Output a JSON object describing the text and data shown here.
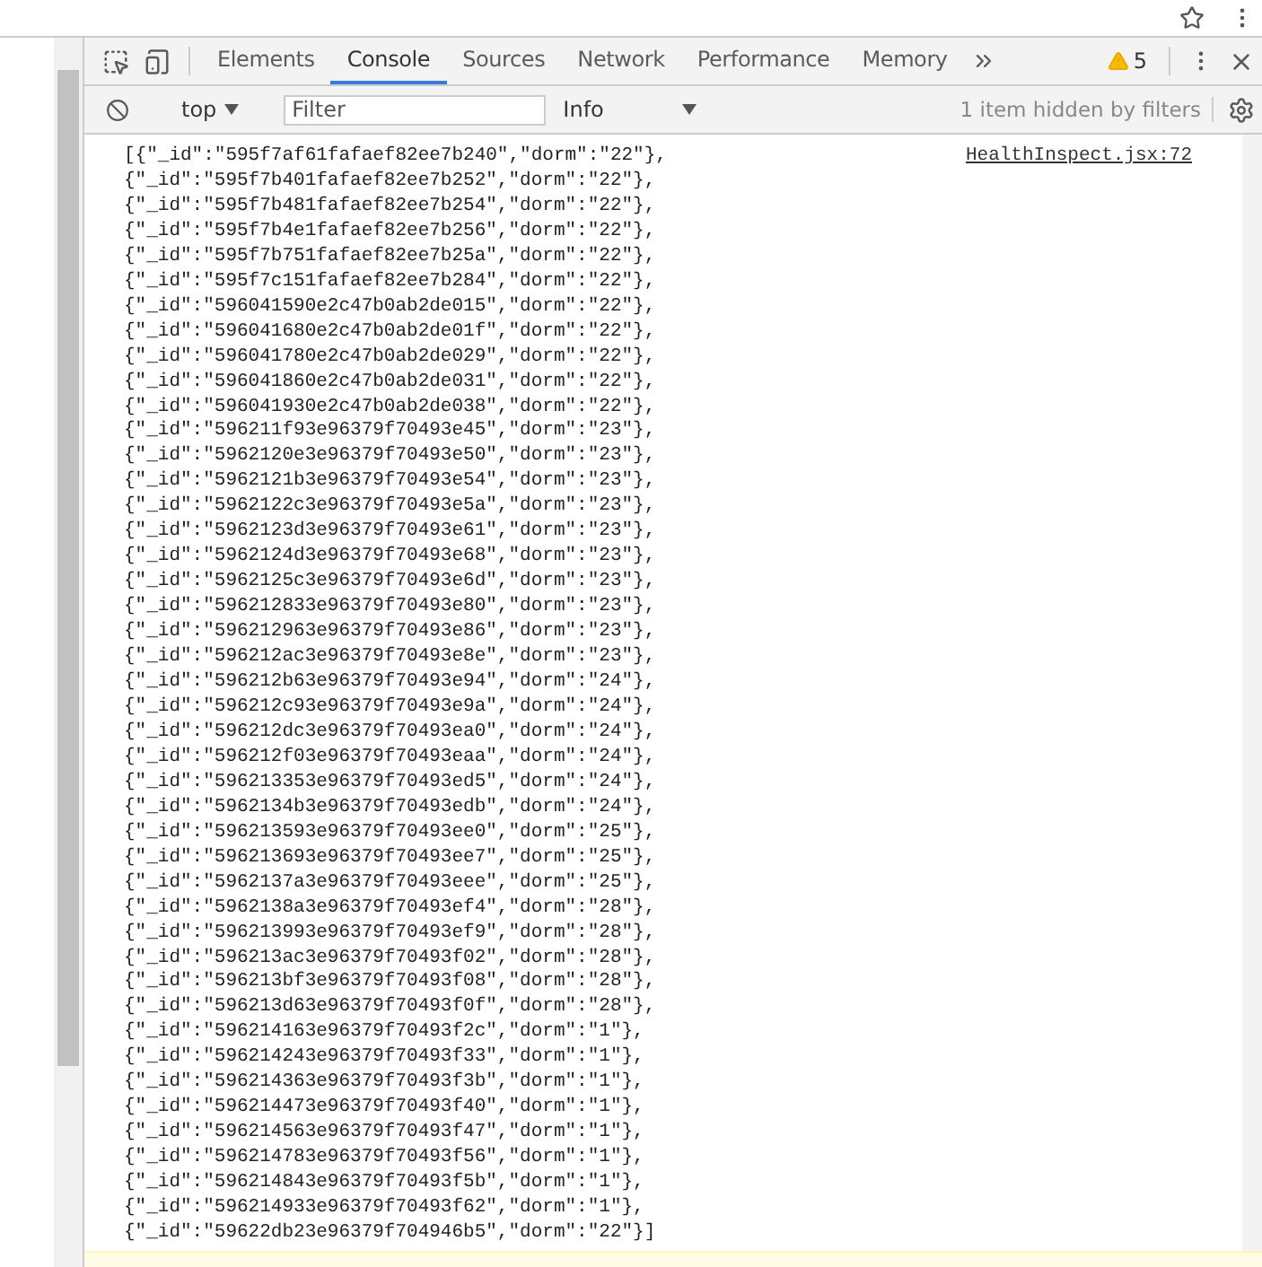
{
  "tabs": [
    {
      "label": "Elements",
      "selected": false
    },
    {
      "label": "Console",
      "selected": true
    },
    {
      "label": "Sources",
      "selected": false
    },
    {
      "label": "Network",
      "selected": false
    },
    {
      "label": "Performance",
      "selected": false
    },
    {
      "label": "Memory",
      "selected": false
    }
  ],
  "warning_count": "5",
  "toolbar": {
    "context": "top",
    "filter": {
      "placeholder": "Filter"
    },
    "level": "Info",
    "hidden_notice": "1 item hidden by filters"
  },
  "console": {
    "source": "HealthInspect.jsx:72",
    "lines": [
      "[{\"_id\":\"595f7af61fafaef82ee7b240\",\"dorm\":\"22\"},",
      "{\"_id\":\"595f7b401fafaef82ee7b252\",\"dorm\":\"22\"},",
      "{\"_id\":\"595f7b481fafaef82ee7b254\",\"dorm\":\"22\"},",
      "{\"_id\":\"595f7b4e1fafaef82ee7b256\",\"dorm\":\"22\"},",
      "{\"_id\":\"595f7b751fafaef82ee7b25a\",\"dorm\":\"22\"},",
      "{\"_id\":\"595f7c151fafaef82ee7b284\",\"dorm\":\"22\"},",
      "{\"_id\":\"596041590e2c47b0ab2de015\",\"dorm\":\"22\"},",
      "{\"_id\":\"596041680e2c47b0ab2de01f\",\"dorm\":\"22\"},",
      "{\"_id\":\"596041780e2c47b0ab2de029\",\"dorm\":\"22\"},",
      "{\"_id\":\"596041860e2c47b0ab2de031\",\"dorm\":\"22\"},",
      "{\"_id\":\"596041930e2c47b0ab2de038\",\"dorm\":\"22\"},",
      "{\"_id\":\"596211f93e96379f70493e45\",\"dorm\":\"23\"},",
      "{\"_id\":\"5962120e3e96379f70493e50\",\"dorm\":\"23\"},",
      "{\"_id\":\"5962121b3e96379f70493e54\",\"dorm\":\"23\"},",
      "{\"_id\":\"5962122c3e96379f70493e5a\",\"dorm\":\"23\"},",
      "{\"_id\":\"5962123d3e96379f70493e61\",\"dorm\":\"23\"},",
      "{\"_id\":\"5962124d3e96379f70493e68\",\"dorm\":\"23\"},",
      "{\"_id\":\"5962125c3e96379f70493e6d\",\"dorm\":\"23\"},",
      "{\"_id\":\"596212833e96379f70493e80\",\"dorm\":\"23\"},",
      "{\"_id\":\"596212963e96379f70493e86\",\"dorm\":\"23\"},",
      "{\"_id\":\"596212ac3e96379f70493e8e\",\"dorm\":\"23\"},",
      "{\"_id\":\"596212b63e96379f70493e94\",\"dorm\":\"24\"},",
      "{\"_id\":\"596212c93e96379f70493e9a\",\"dorm\":\"24\"},",
      "{\"_id\":\"596212dc3e96379f70493ea0\",\"dorm\":\"24\"},",
      "{\"_id\":\"596212f03e96379f70493eaa\",\"dorm\":\"24\"},",
      "{\"_id\":\"596213353e96379f70493ed5\",\"dorm\":\"24\"},",
      "{\"_id\":\"5962134b3e96379f70493edb\",\"dorm\":\"24\"},",
      "{\"_id\":\"596213593e96379f70493ee0\",\"dorm\":\"25\"},",
      "{\"_id\":\"596213693e96379f70493ee7\",\"dorm\":\"25\"},",
      "{\"_id\":\"5962137a3e96379f70493eee\",\"dorm\":\"25\"},",
      "{\"_id\":\"5962138a3e96379f70493ef4\",\"dorm\":\"28\"},",
      "{\"_id\":\"596213993e96379f70493ef9\",\"dorm\":\"28\"},",
      "{\"_id\":\"596213ac3e96379f70493f02\",\"dorm\":\"28\"},",
      "{\"_id\":\"596213bf3e96379f70493f08\",\"dorm\":\"28\"},",
      "{\"_id\":\"596213d63e96379f70493f0f\",\"dorm\":\"28\"},",
      "{\"_id\":\"596214163e96379f70493f2c\",\"dorm\":\"1\"},",
      "{\"_id\":\"596214243e96379f70493f33\",\"dorm\":\"1\"},",
      "{\"_id\":\"596214363e96379f70493f3b\",\"dorm\":\"1\"},",
      "{\"_id\":\"596214473e96379f70493f40\",\"dorm\":\"1\"},",
      "{\"_id\":\"596214563e96379f70493f47\",\"dorm\":\"1\"},",
      "{\"_id\":\"596214783e96379f70493f56\",\"dorm\":\"1\"},",
      "{\"_id\":\"596214843e96379f70493f5b\",\"dorm\":\"1\"},",
      "{\"_id\":\"596214933e96379f70493f62\",\"dorm\":\"1\"},",
      "{\"_id\":\"59622db23e96379f704946b5\",\"dorm\":\"22\"}]"
    ]
  }
}
